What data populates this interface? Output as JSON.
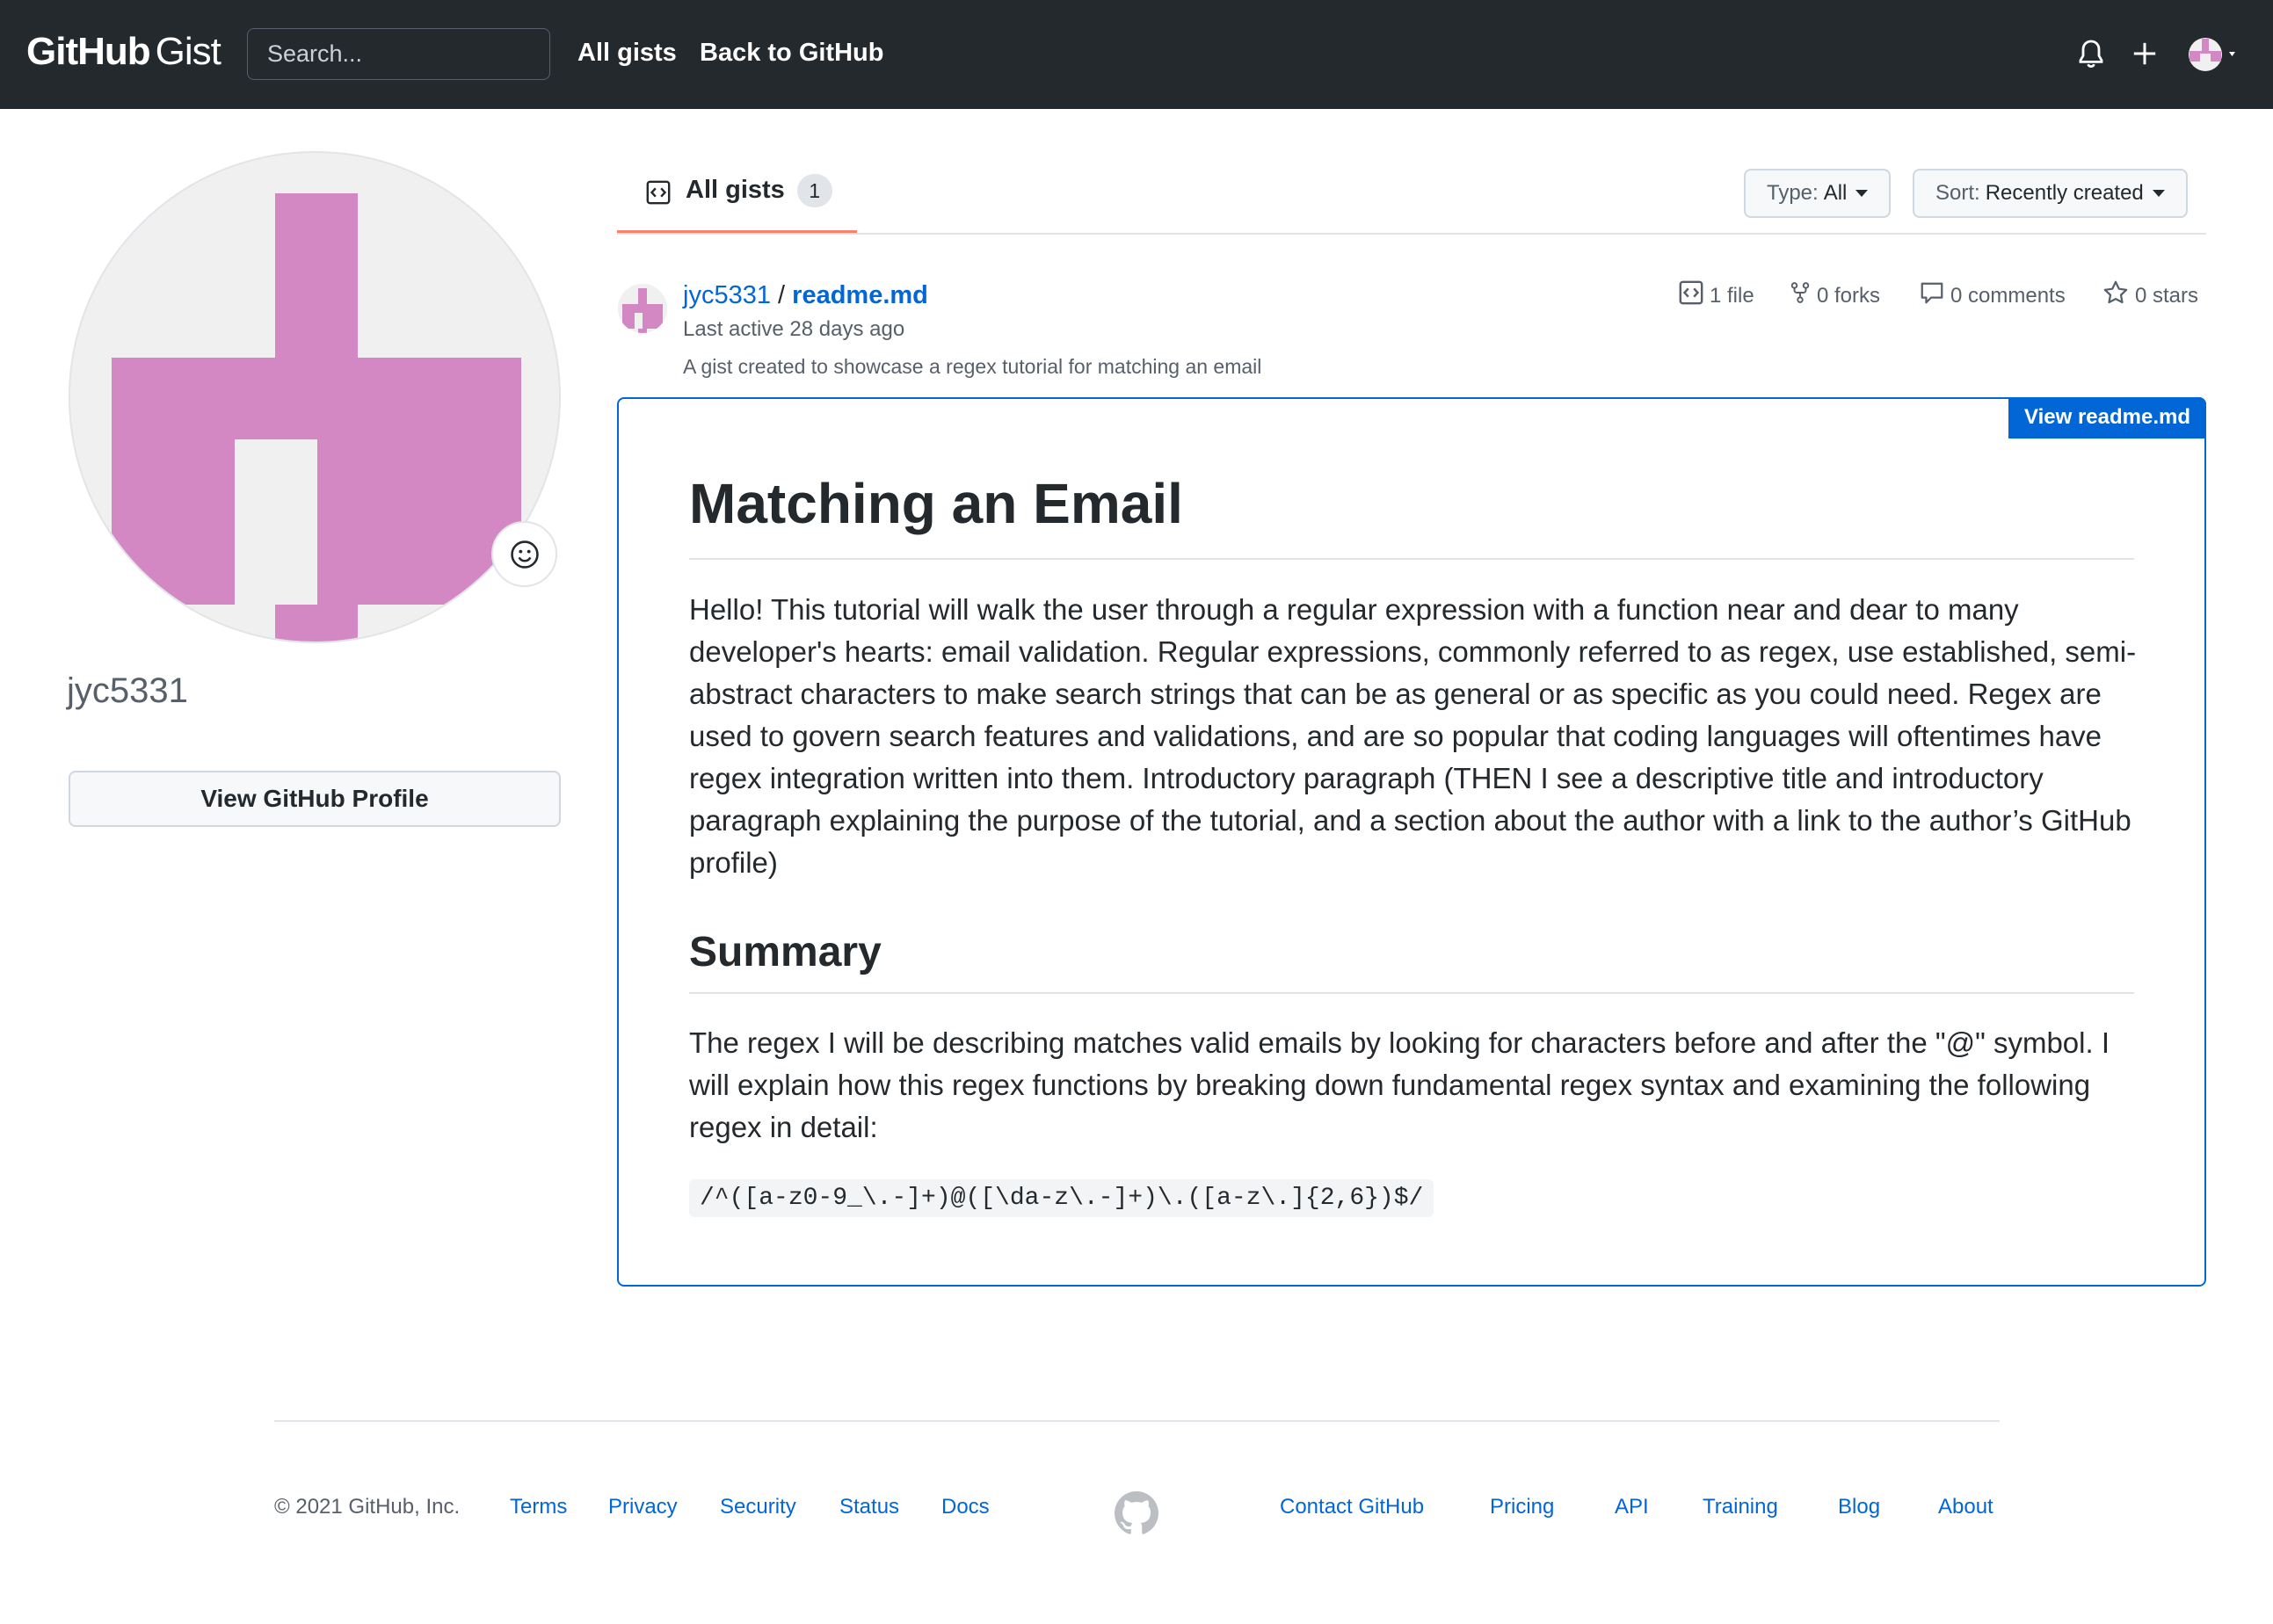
{
  "header": {
    "logo_bold": "GitHub",
    "logo_light": "Gist",
    "search_placeholder": "Search...",
    "nav": [
      "All gists",
      "Back to GitHub"
    ]
  },
  "profile": {
    "username": "jyc5331",
    "view_profile_label": "View GitHub Profile",
    "avatar_color": "#d488c3"
  },
  "tabs": {
    "all_gists_label": "All gists",
    "all_gists_count": "1"
  },
  "filters": {
    "type_prefix": "Type:",
    "type_value": "All",
    "sort_prefix": "Sort:",
    "sort_value": "Recently created"
  },
  "gist": {
    "owner": "jyc5331",
    "separator": "/",
    "filename": "readme.md",
    "last_active": "Last active 28 days ago",
    "description": "A gist created to showcase a regex tutorial for matching an email",
    "files": "1 file",
    "forks": "0 forks",
    "comments": "0 comments",
    "stars": "0 stars",
    "view_file_label": "View readme.md"
  },
  "content": {
    "h1": "Matching an Email",
    "intro": "Hello! This tutorial will walk the user through a regular expression with a function near and dear to many developer's hearts: email validation. Regular expressions, commonly referred to as regex, use established, semi-abstract characters to make search strings that can be as general or as specific as you could need. Regex are used to govern search features and validations, and are so popular that coding languages will oftentimes have regex integration written into them. Introductory paragraph (THEN I see a descriptive title and introductory paragraph explaining the purpose of the tutorial, and a section about the author with a link to the author’s GitHub profile)",
    "h2": "Summary",
    "summary": "The regex I will be describing matches valid emails by looking for characters before and after the \"@\" symbol. I will explain how this regex functions by breaking down fundamental regex syntax and examining the following regex in detail:",
    "code": "/^([a-z0-9_\\.-]+)@([\\da-z\\.-]+)\\.([a-z\\.]{2,6})$/"
  },
  "footer": {
    "copyright": "© 2021 GitHub, Inc.",
    "left_links": [
      "Terms",
      "Privacy",
      "Security",
      "Status",
      "Docs"
    ],
    "right_links": [
      "Contact GitHub",
      "Pricing",
      "API",
      "Training",
      "Blog",
      "About"
    ]
  },
  "colors": {
    "header_bg": "#24292e",
    "link": "#0366d6",
    "tab_accent": "#f9826c"
  }
}
